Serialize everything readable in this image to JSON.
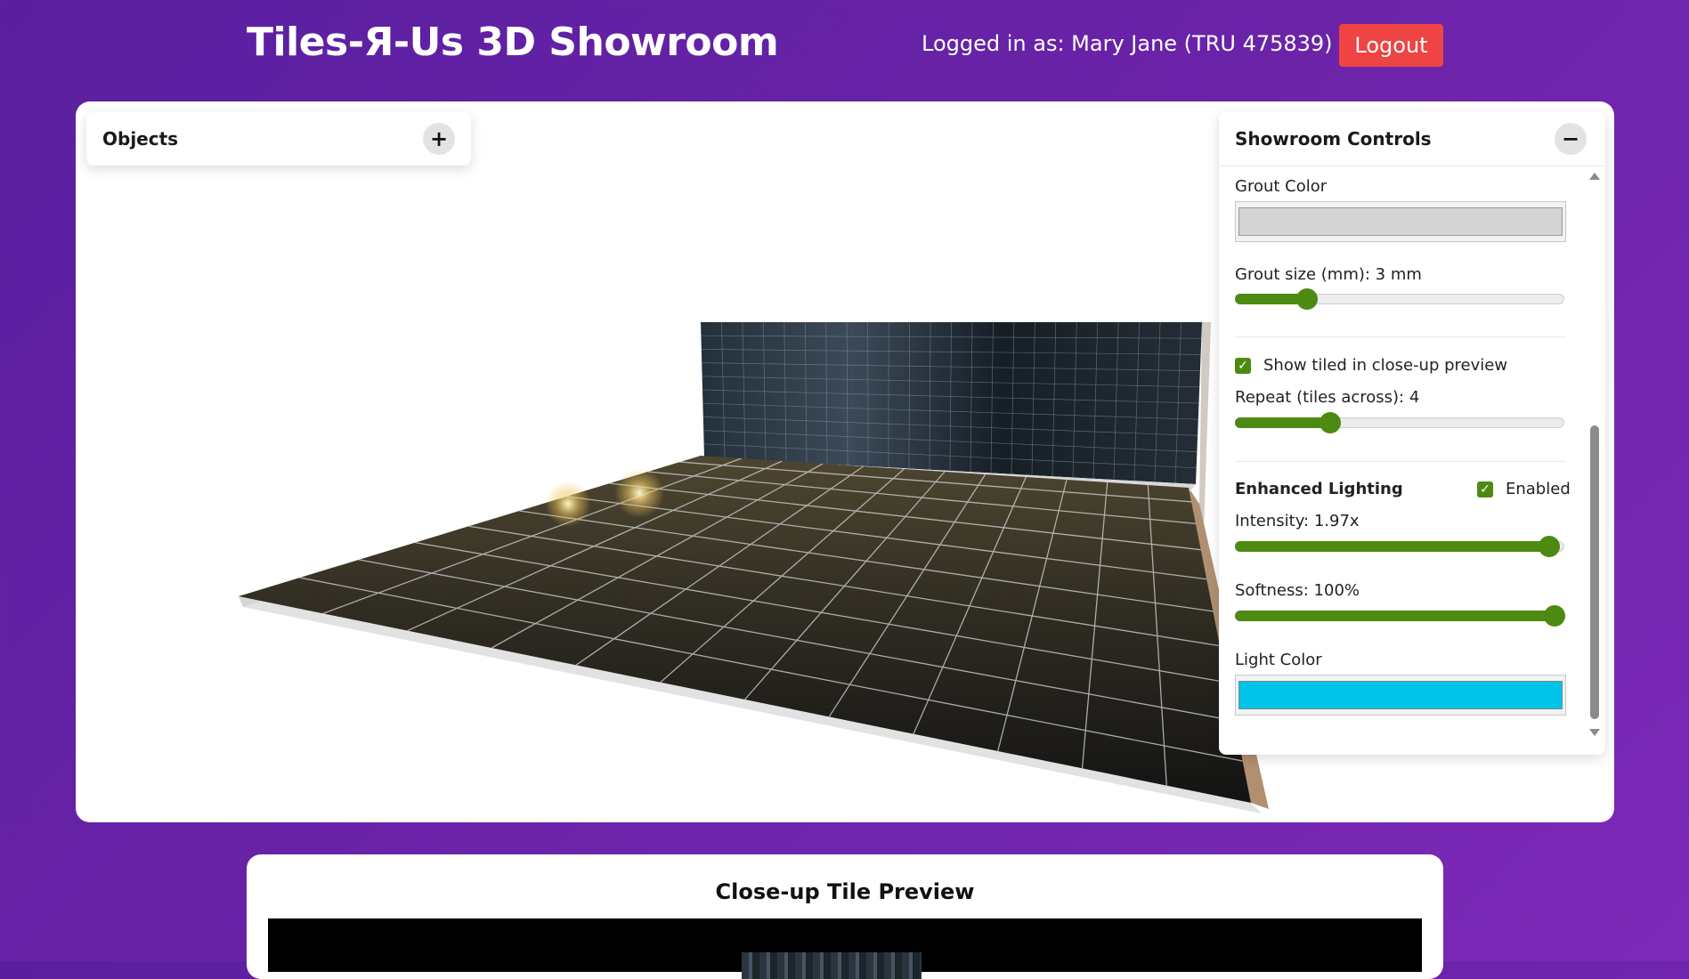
{
  "header": {
    "title": "Tiles-Я-Us 3D Showroom",
    "user_info": "Logged in as: Mary Jane (TRU 475839)",
    "logout_label": "Logout"
  },
  "objects_panel": {
    "title": "Objects",
    "toggle_symbol": "+"
  },
  "controls": {
    "title": "Showroom Controls",
    "toggle_symbol": "−",
    "grout_color_label": "Grout Color",
    "grout_color": "#d4d4d4",
    "grout_size_label": "Grout size (mm): 3 mm",
    "grout_size_fraction": 0.22,
    "show_tiled_checked": true,
    "show_tiled_label": "Show tiled in close-up preview",
    "repeat_label": "Repeat (tiles across): 4",
    "repeat_fraction": 0.29,
    "lighting_title": "Enhanced Lighting",
    "lighting_enabled": true,
    "enabled_label": "Enabled",
    "intensity_label": "Intensity: 1.97x",
    "intensity_fraction": 0.955,
    "softness_label": "Softness: 100%",
    "softness_fraction": 0.97,
    "light_color_label": "Light Color",
    "light_color": "#00c3ea"
  },
  "preview": {
    "title": "Close-up Tile Preview"
  },
  "colors": {
    "accent": "#4d8a12",
    "logout": "#ef4444"
  }
}
